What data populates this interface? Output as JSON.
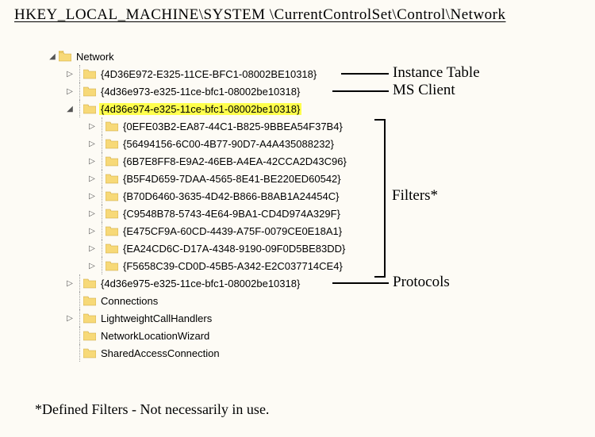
{
  "title": "HKEY_LOCAL_MACHINE\\SYSTEM \\CurrentControlSet\\Control\\Network",
  "root": "Network",
  "nodes": [
    {
      "label": "{4D36E972-E325-11CE-BFC1-08002BE10318}",
      "ann": "Instance Table"
    },
    {
      "label": "{4d36e973-e325-11ce-bfc1-08002be10318}",
      "ann": "MS Client"
    },
    {
      "label": "{4d36e974-e325-11ce-bfc1-08002be10318}",
      "highlight": true
    },
    {
      "label": "{4d36e975-e325-11ce-bfc1-08002be10318}",
      "ann": "Protocols"
    },
    {
      "label": "Connections"
    },
    {
      "label": "LightweightCallHandlers"
    },
    {
      "label": "NetworkLocationWizard"
    },
    {
      "label": "SharedAccessConnection"
    }
  ],
  "children": [
    "{0EFE03B2-EA87-44C1-B825-9BBEA54F37B4}",
    "{56494156-6C00-4B77-90D7-A4A435088232}",
    "{6B7E8FF8-E9A2-46EB-A4EA-42CCA2D43C96}",
    "{B5F4D659-7DAA-4565-8E41-BE220ED60542}",
    "{B70D6460-3635-4D42-B866-B8AB1A24454C}",
    "{C9548B78-5743-4E64-9BA1-CD4D974A329F}",
    "{E475CF9A-60CD-4439-A75F-0079CE0E18A1}",
    "{EA24CD6C-D17A-4348-9190-09F0D5BE83DD}",
    "{F5658C39-CD0D-45B5-A342-E2C037714CE4}"
  ],
  "filters_label": "Filters*",
  "footnote": "*Defined Filters - Not necessarily in use."
}
